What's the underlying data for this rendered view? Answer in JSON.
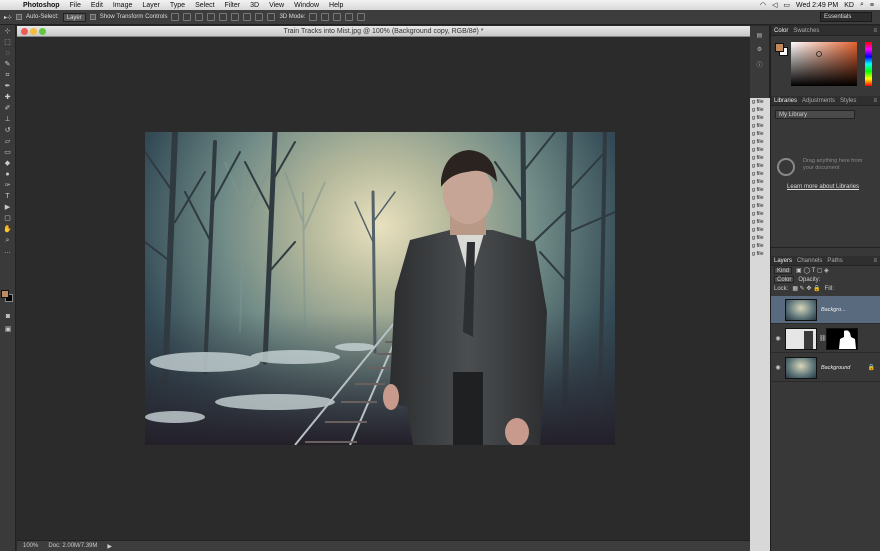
{
  "menubar": {
    "app": "Photoshop",
    "items": [
      "File",
      "Edit",
      "Image",
      "Layer",
      "Type",
      "Select",
      "Filter",
      "3D",
      "View",
      "Window",
      "Help"
    ],
    "clock": "Wed 2:49 PM",
    "user": "KD"
  },
  "options": {
    "auto_select_label": "Auto-Select:",
    "auto_select_value": "Layer",
    "transform_label": "Show Transform Controls",
    "mode_3d_label": "3D Mode:",
    "workspace": "Essentials"
  },
  "document": {
    "title": "Train Tracks into Mist.jpg @ 100% (Background copy, RGB/8#) *",
    "zoom": "100%",
    "doc_size": "Doc: 2.00M/7.39M"
  },
  "color_panel": {
    "tabs": [
      "Color",
      "Swatches"
    ],
    "fg_color": "#c08a60",
    "bg_color": "#ffffff"
  },
  "libraries_panel": {
    "tabs": [
      "Libraries",
      "Adjustments",
      "Styles"
    ],
    "library": "My Library",
    "message": "Drag anything here from your document",
    "link": "Learn more about Libraries"
  },
  "layers_panel": {
    "tabs": [
      "Layers",
      "Channels",
      "Paths"
    ],
    "filter_kind": "Kind",
    "blend_mode": "Color",
    "opacity_label": "Opacity:",
    "lock_label": "Lock:",
    "fill_label": "Fill:",
    "layers": [
      {
        "name": "Backgro...",
        "selected": true
      },
      {
        "name": "",
        "selected": false
      },
      {
        "name": "Background",
        "selected": false
      }
    ]
  },
  "sliver_rows": [
    "g file",
    "g file",
    "g file",
    "g file",
    "g file",
    "g file",
    "g file",
    "g file",
    "g file",
    "g file",
    "g file",
    "g file",
    "g file",
    "g file",
    "g file",
    "g file",
    "g file",
    "g file",
    "g file",
    "g file"
  ]
}
